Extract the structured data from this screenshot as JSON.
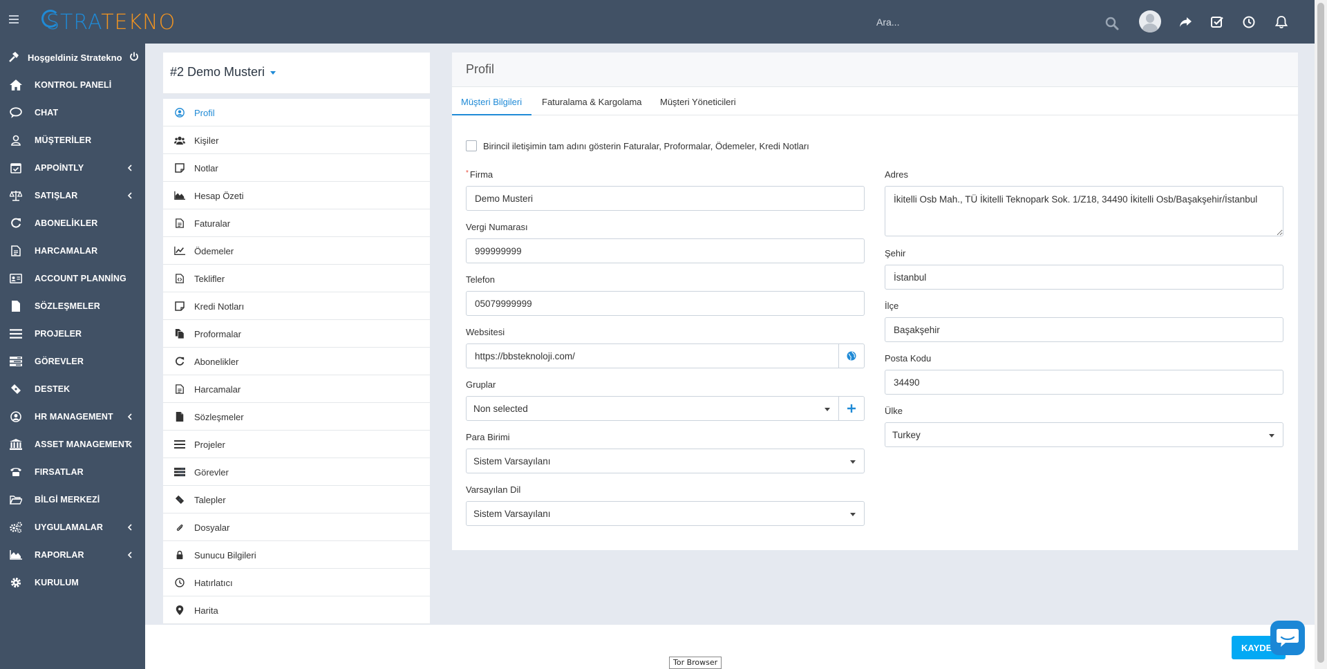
{
  "header": {
    "logo_part1": "STRA",
    "logo_part2": "TEKNO",
    "search_placeholder": "Ara..."
  },
  "sidebar": {
    "welcome": "Hoşgeldiniz Stratekno",
    "items": [
      {
        "label": "KONTROL PANELİ",
        "icon": "home-icon",
        "has_submenu": false
      },
      {
        "label": "CHAT",
        "icon": "chat-icon",
        "has_submenu": false
      },
      {
        "label": "MÜŞTERİLER",
        "icon": "user-icon",
        "has_submenu": false
      },
      {
        "label": "APPOİNTLY",
        "icon": "calendar-check-icon",
        "has_submenu": true
      },
      {
        "label": "SATIŞLAR",
        "icon": "balance-scale-icon",
        "has_submenu": true
      },
      {
        "label": "ABONELİKLER",
        "icon": "refresh-icon",
        "has_submenu": false
      },
      {
        "label": "HARCAMALAR",
        "icon": "file-text-icon",
        "has_submenu": false
      },
      {
        "label": "ACCOUNT PLANNİNG",
        "icon": "id-card-icon",
        "has_submenu": false
      },
      {
        "label": "SÖZLEŞMELER",
        "icon": "file-icon",
        "has_submenu": false
      },
      {
        "label": "PROJELER",
        "icon": "bars-icon",
        "has_submenu": false
      },
      {
        "label": "GÖREVLER",
        "icon": "tasks-icon",
        "has_submenu": false
      },
      {
        "label": "DESTEK",
        "icon": "ticket-icon",
        "has_submenu": false
      },
      {
        "label": "HR MANAGEMENT",
        "icon": "user-circle-icon",
        "has_submenu": true
      },
      {
        "label": "ASSET MANAGEMENT",
        "icon": "bank-icon",
        "has_submenu": true
      },
      {
        "label": "FIRSATLAR",
        "icon": "phone-icon",
        "has_submenu": false
      },
      {
        "label": "BİLGİ MERKEZİ",
        "icon": "folder-open-icon",
        "has_submenu": false
      },
      {
        "label": "UYGULAMALAR",
        "icon": "cogs-icon",
        "has_submenu": true
      },
      {
        "label": "RAPORLAR",
        "icon": "area-chart-icon",
        "has_submenu": true
      },
      {
        "label": "KURULUM",
        "icon": "gear-icon",
        "has_submenu": false
      }
    ]
  },
  "customer": {
    "title": "#2 Demo Musteri"
  },
  "profile_menu": [
    {
      "label": "Profil",
      "icon": "user-circle-icon",
      "active": true
    },
    {
      "label": "Kişiler",
      "icon": "users-icon",
      "active": false
    },
    {
      "label": "Notlar",
      "icon": "sticky-note-icon",
      "active": false
    },
    {
      "label": "Hesap Özeti",
      "icon": "area-chart-icon",
      "active": false
    },
    {
      "label": "Faturalar",
      "icon": "file-text-icon",
      "active": false
    },
    {
      "label": "Ödemeler",
      "icon": "line-chart-icon",
      "active": false
    },
    {
      "label": "Teklifler",
      "icon": "file-code-icon",
      "active": false
    },
    {
      "label": "Kredi Notları",
      "icon": "sticky-note-icon",
      "active": false
    },
    {
      "label": "Proformalar",
      "icon": "files-icon",
      "active": false
    },
    {
      "label": "Abonelikler",
      "icon": "refresh-icon",
      "active": false
    },
    {
      "label": "Harcamalar",
      "icon": "file-text-icon",
      "active": false
    },
    {
      "label": "Sözleşmeler",
      "icon": "file-icon",
      "active": false
    },
    {
      "label": "Projeler",
      "icon": "bars-icon",
      "active": false
    },
    {
      "label": "Görevler",
      "icon": "tasks-icon",
      "active": false
    },
    {
      "label": "Talepler",
      "icon": "ticket-icon",
      "active": false
    },
    {
      "label": "Dosyalar",
      "icon": "paperclip-icon",
      "active": false
    },
    {
      "label": "Sunucu Bilgileri",
      "icon": "lock-icon",
      "active": false
    },
    {
      "label": "Hatırlatıcı",
      "icon": "clock-icon",
      "active": false
    },
    {
      "label": "Harita",
      "icon": "map-marker-icon",
      "active": false
    }
  ],
  "card": {
    "title": "Profil",
    "tabs": [
      "Müşteri Bilgileri",
      "Faturalama & Kargolama",
      "Müşteri Yöneticileri"
    ],
    "checkbox_label": "Birincil iletişimin tam adını gösterin Faturalar, Proformalar, Ödemeler, Kredi Notları"
  },
  "form": {
    "firma": {
      "label": "Firma",
      "value": "Demo Musteri"
    },
    "vergi": {
      "label": "Vergi Numarası",
      "value": "999999999"
    },
    "telefon": {
      "label": "Telefon",
      "value": "05079999999"
    },
    "website": {
      "label": "Websitesi",
      "value": "https://bbsteknoloji.com/"
    },
    "gruplar": {
      "label": "Gruplar",
      "value": "Non selected"
    },
    "para_birimi": {
      "label": "Para Birimi",
      "value": "Sistem Varsayılanı"
    },
    "varsayilan_dil": {
      "label": "Varsayılan Dil",
      "value": "Sistem Varsayılanı"
    },
    "adres": {
      "label": "Adres",
      "value": "İkitelli Osb Mah., TÜ İkitelli Teknopark Sok. 1/Z18, 34490 İkitelli Osb/Başakşehir/İstanbul"
    },
    "sehir": {
      "label": "Şehir",
      "value": "İstanbul"
    },
    "ilce": {
      "label": "İlçe",
      "value": "Başakşehir"
    },
    "posta_kodu": {
      "label": "Posta Kodu",
      "value": "34490"
    },
    "ulke": {
      "label": "Ülke",
      "value": "Turkey"
    }
  },
  "footer": {
    "save_label": "KAYDE",
    "tooltip": "Tor Browser"
  }
}
